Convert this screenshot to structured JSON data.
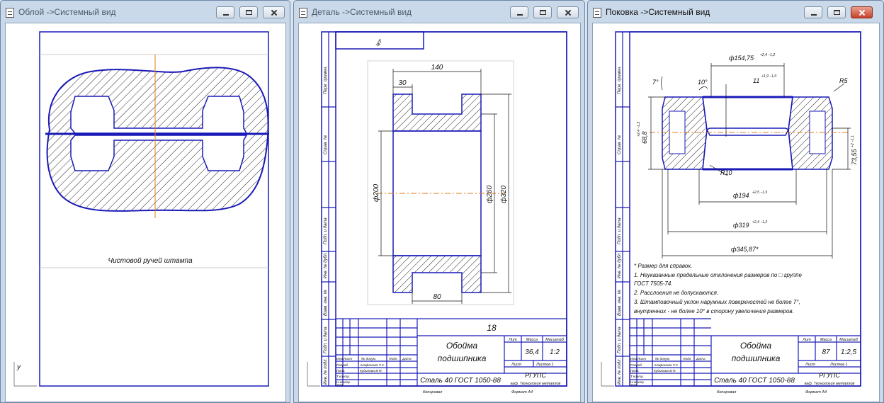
{
  "windows": [
    {
      "title": "Облой ->Системный вид",
      "active": false,
      "drawing": {
        "caption": "Чистовой ручей штампа"
      }
    },
    {
      "title": "Деталь ->Системный вид",
      "active": false,
      "drawing": {
        "roughness": "∜",
        "dims": {
          "d140": "140",
          "d30": "30",
          "d80": "80",
          "d200": "ф200",
          "d260": "ф260",
          "d320": "ф320"
        },
        "title_block": {
          "num": "18",
          "name_line1": "Обойма",
          "name_line2": "подшипника",
          "material": "Сталь 40 ГОСТ 1050-88",
          "org": "РГУПС",
          "dept": "каф. Технология металлов",
          "mass": "36,4",
          "scale": "1:2",
          "lit_hdr": "Лит",
          "mass_hdr": "Масса",
          "scale_hdr": "Масштаб",
          "sheet_hdr": "Лист",
          "sheets_hdr": "Листов 1",
          "izm": "Изм",
          "list": "Лист",
          "ndoc": "№ докум.",
          "podp": "Подп.",
          "data": "Дата",
          "razrab": "Разраб.",
          "prov": "Пров.",
          "tkontr": "Т.контр.",
          "nkontr": "Н.контр.",
          "utv": "Утв.",
          "author": "Агафонова Т.С.",
          "checker": "Кудинова В.Ф.",
          "kopiroval": "Копировал",
          "format": "Формат   А4"
        },
        "side_labels": [
          "Перв. примен.",
          "Справ. №",
          "Подп. и дата",
          "Инв. № дубл.",
          "Взам. инв. №",
          "Подп. и дата",
          "Инв. № подл."
        ]
      }
    },
    {
      "title": "Поковка ->Системный вид",
      "active": true,
      "drawing": {
        "dims": {
          "d154": "ф154,75",
          "d154_tol": "+2,4 −1,2",
          "d194": "ф194",
          "d194_tol": "+2,5 −1,5",
          "d319": "ф319",
          "d319_tol": "+2,4 −1,2",
          "d345": "ф345,87*",
          "h68": "68,8",
          "h68_tol": "+2,4 −1,2",
          "h73": "73,55",
          "h73_tol": "+2 −1,1",
          "a7": "7°",
          "a10": "10°",
          "r11": "11",
          "r11_tol": "+1,9 −1,0",
          "r10": "R10",
          "r5": "R5"
        },
        "notes": [
          "* Размер для справок.",
          "1. Неуказанные предельные отклонения размеров по □ группе",
          "ГОСТ 7505-74.",
          "2. Расслоения не допускаются.",
          "3. Штамповочный уклон наружных поверхностей не более 7°,",
          "внутренних - не более 10° в сторону увеличения размеров."
        ],
        "title_block": {
          "name_line1": "Обойма",
          "name_line2": "подшипника",
          "material": "Сталь 40 ГОСТ 1050-88",
          "org": "РГУПС",
          "dept": "каф. Технология металлов",
          "mass": "87",
          "scale": "1:2,5",
          "lit_hdr": "Лит",
          "mass_hdr": "Масса",
          "scale_hdr": "Масштаб",
          "sheet_hdr": "Лист",
          "sheets_hdr": "Листов 1",
          "izm": "Изм",
          "list": "Лист",
          "ndoc": "№ докум.",
          "podp": "Подп.",
          "data": "Дата",
          "razrab": "Разраб.",
          "prov": "Пров.",
          "tkontr": "Т.контр.",
          "nkontr": "Н.контр.",
          "utv": "Утв.",
          "author": "Агафонова Т.С.",
          "checker": "Кудинова В.Ф.",
          "kopiroval": "Копировал",
          "format": "Формат   А4"
        },
        "side_labels": [
          "Перв. примен.",
          "Справ. №",
          "Подп. и дата",
          "Инв. № дубл.",
          "Взам. инв. №",
          "Подп. и дата",
          "Инв. № подл."
        ]
      }
    }
  ],
  "colors": {
    "outline": "#1a1ab8",
    "axis": "#e07c1c",
    "hatch": "#222222"
  }
}
